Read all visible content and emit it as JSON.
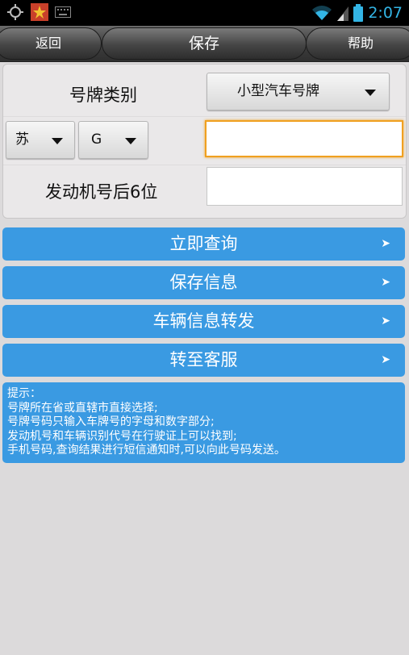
{
  "status_bar": {
    "time": "2:07",
    "icons": [
      "target-icon",
      "app-star-icon",
      "keyboard-icon",
      "wifi-icon",
      "signal-icon",
      "battery-icon"
    ]
  },
  "toolbar": {
    "back_label": "返回",
    "title": "保存",
    "help_label": "帮助"
  },
  "form": {
    "plate_type_label": "号牌类别",
    "plate_type_value": "小型汽车号牌",
    "province_value": "苏",
    "city_letter_value": "G",
    "plate_number_value": "",
    "engine_label": "发动机号后6位",
    "engine_value": ""
  },
  "actions": {
    "query_label": "立即查询",
    "save_label": "保存信息",
    "forward_label": "车辆信息转发",
    "service_label": "转至客服",
    "chevron": "➤"
  },
  "tips": {
    "title": "提示：",
    "lines": [
      " 号牌所在省或直辖市直接选择;",
      " 号牌号码只输入车牌号的字母和数字部分;",
      " 发动机号和车辆识别代号在行驶证上可以找到;",
      " 手机号码,查询结果进行短信通知时,可以向此号码发送。"
    ]
  },
  "colors": {
    "accent_blue": "#3a9ae2",
    "status_blue": "#33b5e5",
    "focus_orange": "#f0a020"
  }
}
